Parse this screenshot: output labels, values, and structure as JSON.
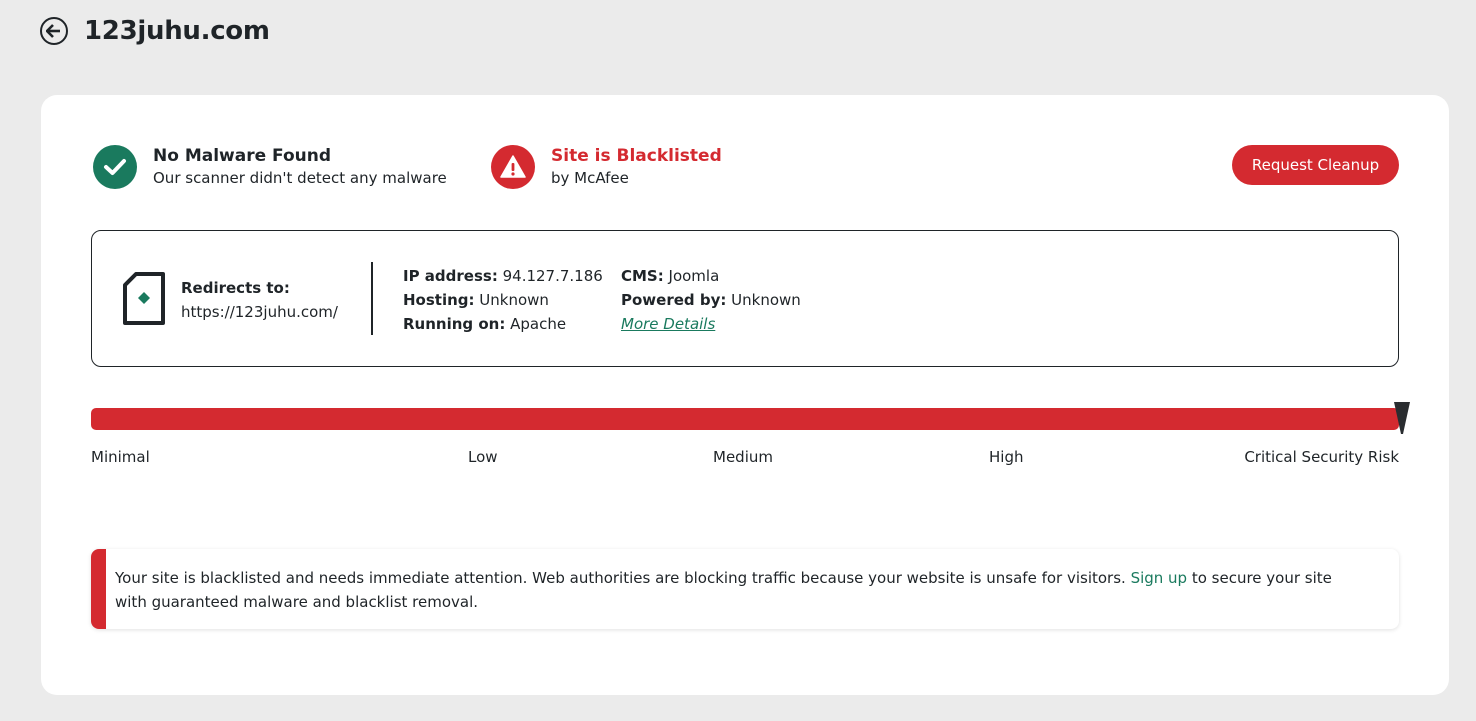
{
  "header": {
    "site_title": "123juhu.com"
  },
  "status": {
    "malware": {
      "title": "No Malware Found",
      "subtitle": "Our scanner didn't detect any malware",
      "color": "#1a7a5e"
    },
    "blacklist": {
      "title": "Site is Blacklisted",
      "subtitle": "by McAfee",
      "color": "#d42a30"
    },
    "cleanup_button": "Request Cleanup"
  },
  "info": {
    "redirect_label": "Redirects to:",
    "redirect_url": "https://123juhu.com/",
    "ip_label": "IP address:",
    "ip_value": "94.127.7.186",
    "hosting_label": "Hosting:",
    "hosting_value": "Unknown",
    "running_label": "Running on:",
    "running_value": "Apache",
    "cms_label": "CMS:",
    "cms_value": "Joomla",
    "powered_label": "Powered by:",
    "powered_value": "Unknown",
    "more_details": "More Details"
  },
  "risk": {
    "labels": [
      "Minimal",
      "Low",
      "Medium",
      "High",
      "Critical Security Risk"
    ],
    "level": 1.0,
    "bar_color": "#d42a30"
  },
  "alert": {
    "text_before": "Your site is blacklisted and needs immediate attention. Web authorities are blocking traffic because your website is unsafe for visitors. ",
    "link": "Sign up",
    "text_after": " to secure your site with guaranteed malware and blacklist removal."
  },
  "colors": {
    "accent_green": "#1a7a5e",
    "danger_red": "#d42a30",
    "background": "#ebebeb"
  }
}
